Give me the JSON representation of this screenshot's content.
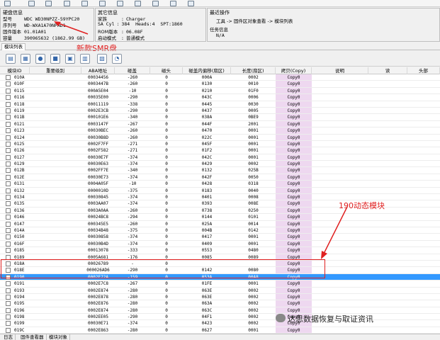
{
  "disk_info": {
    "title": "硬盘信息",
    "model_label": "型号",
    "model_value": "WDC WD30NPZZ-59YPC20",
    "serial_label": "序列号",
    "serial_value": "WD-WXA1A70NPAD1",
    "firmware_label": "固件版本",
    "firmware_value": "01.01A01",
    "capacity_label": "容量",
    "capacity_value": "390965632 (1862.99 GB)"
  },
  "other_info": {
    "title": "其它信息",
    "family_label": "家族",
    "family_value": "Charger",
    "sa_label": "SA Cyl",
    "sa_value": "384",
    "heads_label": "Heads",
    "heads_value": "4",
    "spt_label": "SPT",
    "spt_value": "1860",
    "rom_label": "ROM版本",
    "rom_value": "06.08F",
    "boot_label": "启动模式",
    "boot_value": "普通模式"
  },
  "last_action": {
    "title": "最近操作",
    "value": "工具 -> 固件区对象查看 -> 模块列表"
  },
  "task_info": {
    "title": "任务信息",
    "value": "N/A"
  },
  "annotations": {
    "new_smr": "新款SMR盘",
    "dynamic_module": "190动态模块"
  },
  "tabs": {
    "module_list": "模块列表"
  },
  "table": {
    "headers": [
      "模块ID",
      "重要级别",
      "ABA地址",
      "碰盖",
      "磁头",
      "碰盖内偏移(扇区)",
      "长度(扇区)",
      "拷贝(Copy)",
      "说明",
      "读",
      "头部"
    ],
    "rows": [
      [
        "010A",
        "",
        "00034456",
        "-260",
        "0",
        "000A",
        "0002",
        "Copy0"
      ],
      [
        "010F",
        "",
        "0003447B",
        "-260",
        "0",
        "0130",
        "0010",
        "Copy0"
      ],
      [
        "0115",
        "",
        "000A5E04",
        "-10",
        "0",
        "0210",
        "01F0",
        "Copy0"
      ],
      [
        "0116",
        "",
        "00035E00",
        "-290",
        "0",
        "043C",
        "0006",
        "Copy0"
      ],
      [
        "0118",
        "",
        "00011119",
        "-338",
        "0",
        "0445",
        "0030",
        "Copy0"
      ],
      [
        "0119",
        "",
        "0002E3CB",
        "-290",
        "0",
        "0437",
        "0005",
        "Copy0"
      ],
      [
        "011B",
        "",
        "000101E6",
        "-340",
        "0",
        "038A",
        "0BE9",
        "Copy0"
      ],
      [
        "0121",
        "",
        "0003147F",
        "-267",
        "0",
        "044F",
        "2001",
        "Copy0"
      ],
      [
        "0123",
        "",
        "00030BEC",
        "-260",
        "0",
        "0470",
        "0001",
        "Copy0"
      ],
      [
        "0124",
        "",
        "00030B8D",
        "-260",
        "0",
        "022C",
        "0001",
        "Copy0"
      ],
      [
        "0125",
        "",
        "0002F7FF",
        "-271",
        "0",
        "045F",
        "0001",
        "Copy0"
      ],
      [
        "0126",
        "",
        "0002F582",
        "-271",
        "0",
        "01F2",
        "0001",
        "Copy0"
      ],
      [
        "0127",
        "",
        "00030E7F",
        "-374",
        "0",
        "042C",
        "0001",
        "Copy0"
      ],
      [
        "0129",
        "",
        "00030E63",
        "-374",
        "0",
        "0429",
        "0002",
        "Copy0"
      ],
      [
        "012B",
        "",
        "0002FF7E",
        "-340",
        "0",
        "0132",
        "025B",
        "Copy0"
      ],
      [
        "012E",
        "",
        "00030E73",
        "-374",
        "0",
        "042F",
        "0050",
        "Copy0"
      ],
      [
        "0131",
        "",
        "0004A05F",
        "-10",
        "0",
        "0428",
        "0318",
        "Copy0"
      ],
      [
        "0132",
        "",
        "0000010D",
        "-375",
        "0",
        "0183",
        "0040",
        "Copy0"
      ],
      [
        "0134",
        "",
        "00030845",
        "-374",
        "0",
        "0401",
        "0008",
        "Copy0"
      ],
      [
        "0135",
        "",
        "0003AA07",
        "-374",
        "0",
        "0393",
        "008E",
        "Copy0"
      ],
      [
        "0136",
        "",
        "0003A0AA",
        "-260",
        "0",
        "0738",
        "0250",
        "Copy0"
      ],
      [
        "0146",
        "",
        "00024BC8",
        "-294",
        "0",
        "0144",
        "0101",
        "Copy0"
      ],
      [
        "0147",
        "",
        "000345E5",
        "-260",
        "0",
        "025A",
        "0014",
        "Copy0"
      ],
      [
        "014A",
        "",
        "00034B48",
        "-375",
        "0",
        "004B",
        "0142",
        "Copy0"
      ],
      [
        "0150",
        "",
        "00030858",
        "-374",
        "0",
        "0417",
        "0001",
        "Copy0"
      ],
      [
        "016F",
        "",
        "00030B4D",
        "-374",
        "0",
        "0409",
        "0001",
        "Copy0"
      ],
      [
        "0185",
        "",
        "00013078",
        "-333",
        "0",
        "0553",
        "0480",
        "Copy0"
      ],
      [
        "0189",
        "",
        "0005A681",
        "-176",
        "0",
        "0085",
        "0089",
        "Copy0"
      ],
      [
        "018A",
        "",
        "00026789",
        "-",
        "0",
        "",
        "",
        "Copy0"
      ],
      [
        "018E",
        "",
        "000026AD6",
        "-290",
        "0",
        "0142",
        "0080",
        "Copy0"
      ],
      [
        "0190",
        "",
        "0002E72A",
        "-159",
        "0",
        "053A",
        "00A8",
        "Copy0"
      ],
      [
        "0191",
        "",
        "0002E7C8",
        "-267",
        "0",
        "01FE",
        "0001",
        "Copy0"
      ],
      [
        "0193",
        "",
        "0002E874",
        "-280",
        "0",
        "063E",
        "0002",
        "Copy0"
      ],
      [
        "0194",
        "",
        "0002E878",
        "-280",
        "0",
        "063E",
        "0002",
        "Copy0"
      ],
      [
        "0195",
        "",
        "0002E876",
        "-280",
        "0",
        "063A",
        "0002",
        "Copy0"
      ],
      [
        "0196",
        "",
        "0002E874",
        "-280",
        "0",
        "063C",
        "0002",
        "Copy0"
      ],
      [
        "0198",
        "",
        "0002EE05",
        "-290",
        "0",
        "04F1",
        "0002",
        "Copy0"
      ],
      [
        "0199",
        "",
        "00030E71",
        "-374",
        "0",
        "0423",
        "0002",
        "Copy0"
      ],
      [
        "019C",
        "",
        "0002E863",
        "-280",
        "0",
        "0627",
        "0001",
        "Copy0"
      ],
      [
        "019E",
        "",
        "000344E9",
        "-260",
        "0",
        "0026",
        "0001",
        "Copy0"
      ]
    ],
    "selected_index": 30
  },
  "status_tabs": [
    "日志",
    "固件查看器",
    "模块对象"
  ],
  "watermark": "达思数据恢复与取证资讯"
}
